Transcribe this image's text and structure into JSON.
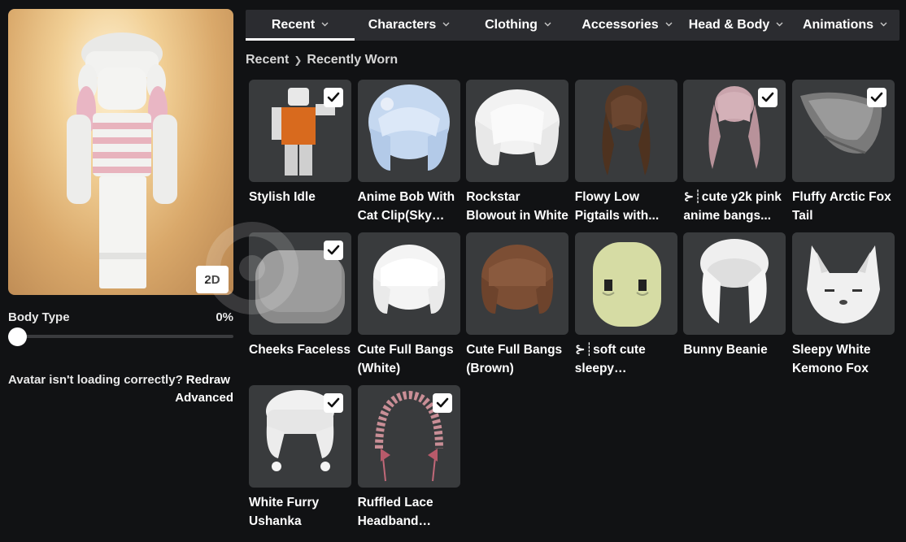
{
  "avatar": {
    "view_toggle_label": "2D",
    "body_type_label": "Body Type",
    "body_type_value": "0%",
    "body_type_level": 0,
    "loading_prompt": "Avatar isn't loading correctly?",
    "redraw_label": "Redraw",
    "advanced_label": "Advanced"
  },
  "tabs": [
    {
      "label": "Recent",
      "active": true
    },
    {
      "label": "Characters",
      "active": false
    },
    {
      "label": "Clothing",
      "active": false
    },
    {
      "label": "Accessories",
      "active": false
    },
    {
      "label": "Head & Body",
      "active": false
    },
    {
      "label": "Animations",
      "active": false
    }
  ],
  "breadcrumb": {
    "root": "Recent",
    "current": "Recently Worn"
  },
  "items": [
    {
      "name": "Stylish Idle",
      "icon": "animation-figure",
      "worn": true
    },
    {
      "name": "Anime Bob With Cat Clip(Sky Blue)",
      "display": "Anime Bob With Cat Clip(Sky...",
      "icon": "blue-bob-hair",
      "worn": false
    },
    {
      "name": "Rockstar Blowout in White",
      "icon": "white-blowout-hair",
      "worn": false
    },
    {
      "name": "Flowy Low Pigtails with...",
      "icon": "brown-pigtails-hair",
      "worn": false
    },
    {
      "name": "⊱┊cute y2k pink anime bangs...",
      "icon": "pink-pigtails-hair",
      "worn": true
    },
    {
      "name": "Fluffy Arctic Fox Tail",
      "icon": "fox-tail",
      "worn": true
    },
    {
      "name": "Cheeks Faceless",
      "icon": "faceless-head",
      "worn": true
    },
    {
      "name": "Cute Full Bangs (White)",
      "icon": "white-bangs-hair",
      "worn": false
    },
    {
      "name": "Cute Full Bangs (Brown)",
      "icon": "brown-bangs-hair",
      "worn": false
    },
    {
      "name": "⊱┊soft cute sleepy eyebags...",
      "icon": "sleepy-eyes-head",
      "worn": false
    },
    {
      "name": "Bunny Beanie",
      "icon": "bunny-beanie-hat",
      "worn": false
    },
    {
      "name": "Sleepy White Kemono Fox",
      "icon": "fox-head",
      "worn": false
    },
    {
      "name": "White Furry Ushanka",
      "icon": "ushanka-hat",
      "worn": true
    },
    {
      "name": "Ruffled Lace Headband (Pink...",
      "icon": "lace-headband",
      "worn": true
    }
  ],
  "colors": {
    "background": "#111214",
    "tab_bar": "#2b2c30",
    "thumb_bg": "#393b3d",
    "accent": "#ffffff"
  }
}
